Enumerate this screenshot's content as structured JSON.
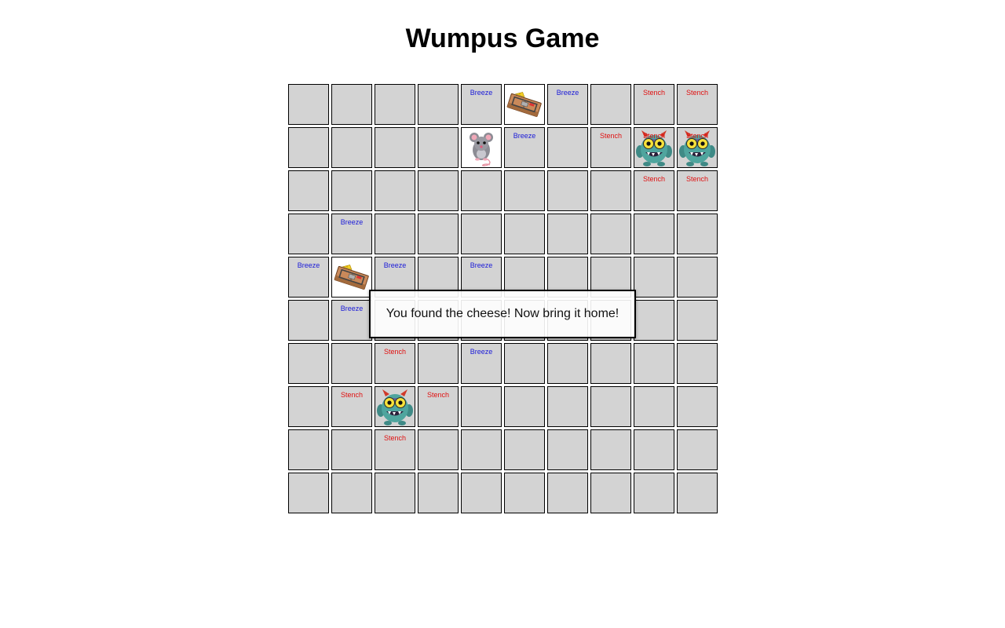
{
  "title": "Wumpus Game",
  "message": "You found the cheese! Now bring it home!",
  "hint_labels": {
    "breeze": "Breeze",
    "stench": "Stench"
  },
  "colors": {
    "breeze": "#1a1ad8",
    "stench": "#e01010",
    "cell": "#d3d3d3",
    "revealed": "#ffffff"
  },
  "grid": {
    "rows": 10,
    "cols": 10,
    "cells": [
      [
        "",
        "",
        "",
        "",
        "breeze",
        "trap-icon",
        "breeze",
        "",
        "stench",
        "stench"
      ],
      [
        "",
        "",
        "",
        "",
        "mouse-icon",
        "breeze",
        "",
        "stench",
        "stench+wumpus-icon",
        "stench+wumpus-icon"
      ],
      [
        "",
        "",
        "",
        "",
        "",
        "",
        "",
        "",
        "stench",
        "stench"
      ],
      [
        "",
        "breeze",
        "",
        "",
        "",
        "",
        "",
        "",
        "",
        ""
      ],
      [
        "breeze",
        "trap-icon",
        "breeze",
        "",
        "breeze",
        "",
        "",
        "",
        "",
        ""
      ],
      [
        "",
        "breeze",
        "",
        "",
        "",
        "",
        "",
        "",
        "",
        ""
      ],
      [
        "",
        "",
        "stench",
        "",
        "breeze",
        "",
        "",
        "",
        "",
        ""
      ],
      [
        "",
        "stench",
        "wumpus-icon",
        "stench",
        "",
        "",
        "",
        "",
        "",
        ""
      ],
      [
        "",
        "",
        "stench",
        "",
        "",
        "",
        "",
        "",
        "",
        ""
      ],
      [
        "",
        "",
        "",
        "",
        "",
        "",
        "",
        "",
        "",
        ""
      ]
    ]
  }
}
